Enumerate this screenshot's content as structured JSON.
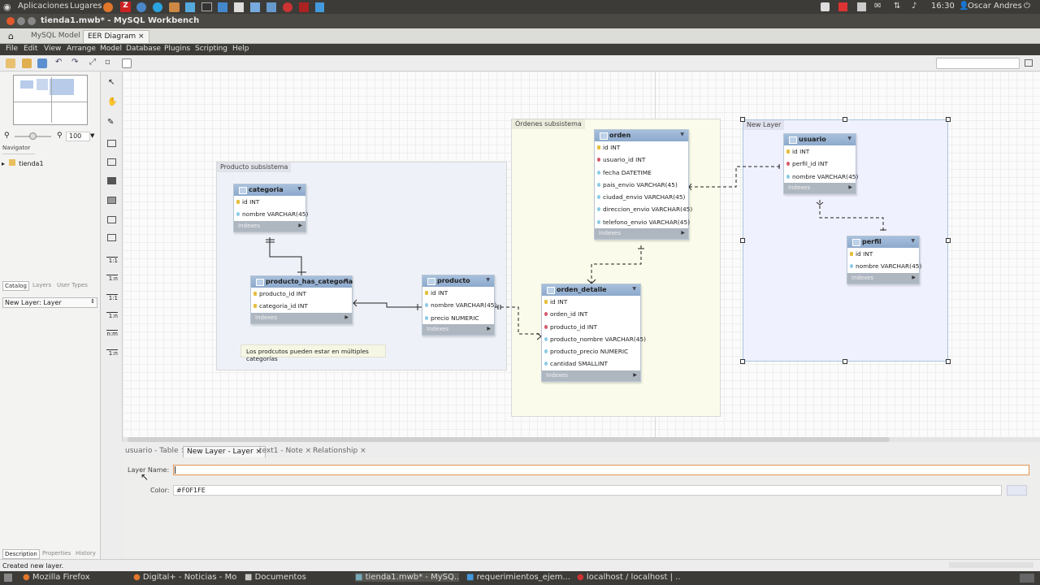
{
  "topbar": {
    "applications": "Aplicaciones",
    "places": "Lugares",
    "time": "16:30",
    "user": "Oscar Andres"
  },
  "window_title": "tienda1.mwb* - MySQL Workbench",
  "doc_tabs": [
    {
      "label": "MySQL Model"
    },
    {
      "label": "EER Diagram"
    }
  ],
  "menu": [
    "File",
    "Edit",
    "View",
    "Arrange",
    "Model",
    "Database",
    "Plugins",
    "Scripting",
    "Help"
  ],
  "navigator": {
    "zoom": "100",
    "tab": "Navigator",
    "tree_item": "tienda1"
  },
  "left_tabs": [
    "Catalog",
    "Layers",
    "User Types"
  ],
  "layer_select": "New Layer: Layer",
  "ratio_labels": [
    "1:1",
    "1:n",
    "1:1",
    "1:n",
    "n:m",
    "1:n"
  ],
  "layers": {
    "producto": "Producto subsistema",
    "ordenes": "Órdenes subsistema",
    "new": "New Layer"
  },
  "tables": {
    "categoria": {
      "name": "categoria",
      "cols": [
        "id INT",
        "nombre VARCHAR(45)"
      ],
      "indexes": "Indexes"
    },
    "producto_has_categoria": {
      "name": "producto_has_categoria",
      "cols": [
        "producto_id INT",
        "categoria_id INT"
      ],
      "indexes": "Indexes"
    },
    "producto": {
      "name": "producto",
      "cols": [
        "id INT",
        "nombre VARCHAR(45)",
        "precio NUMERIC"
      ],
      "indexes": "Indexes"
    },
    "orden": {
      "name": "orden",
      "cols": [
        "id INT",
        "usuario_id INT",
        "fecha DATETIME",
        "pais_envio VARCHAR(45)",
        "ciudad_envio VARCHAR(45)",
        "direccion_envio VARCHAR(45)",
        "telefono_envio VARCHAR(45)"
      ],
      "indexes": "Indexes"
    },
    "orden_detalle": {
      "name": "orden_detalle",
      "cols": [
        "id INT",
        "orden_id INT",
        "producto_id INT",
        "producto_nombre VARCHAR(45)",
        "producto_precio NUMERIC",
        "cantidad SMALLINT"
      ],
      "indexes": "Indexes"
    },
    "usuario": {
      "name": "usuario",
      "cols": [
        "id INT",
        "perfil_id INT",
        "nombre VARCHAR(45)"
      ],
      "indexes": "Indexes"
    },
    "perfil": {
      "name": "perfil",
      "cols": [
        "id INT",
        "nombre VARCHAR(45)"
      ],
      "indexes": "Indexes"
    }
  },
  "note": "Los prodcutos pueden estar en múltiples categorías",
  "bottom_tabs": [
    "usuario - Table",
    "New Layer - Layer",
    "text1 - Note",
    "Relationship"
  ],
  "editor": {
    "layer_name_label": "Layer Name:",
    "layer_name_value": "",
    "color_label": "Color:",
    "color_value": "#F0F1FE"
  },
  "left_bottom_tabs": [
    "Description",
    "Properties",
    "History"
  ],
  "status": "Created new layer.",
  "taskbar": [
    "Mozilla Firefox",
    "Digital+ - Noticias - Mo...",
    "Documentos",
    "tienda1.mwb* - MySQ...",
    "requerimientos_ejem...",
    "localhost / localhost | ..."
  ],
  "colors": {
    "new_layer": "#F0F1FE",
    "producto_layer": "#EEF2F8",
    "ordenes_layer": "#FAFBEA",
    "table_header": "#8CA9CC",
    "accent": "#E29350"
  }
}
